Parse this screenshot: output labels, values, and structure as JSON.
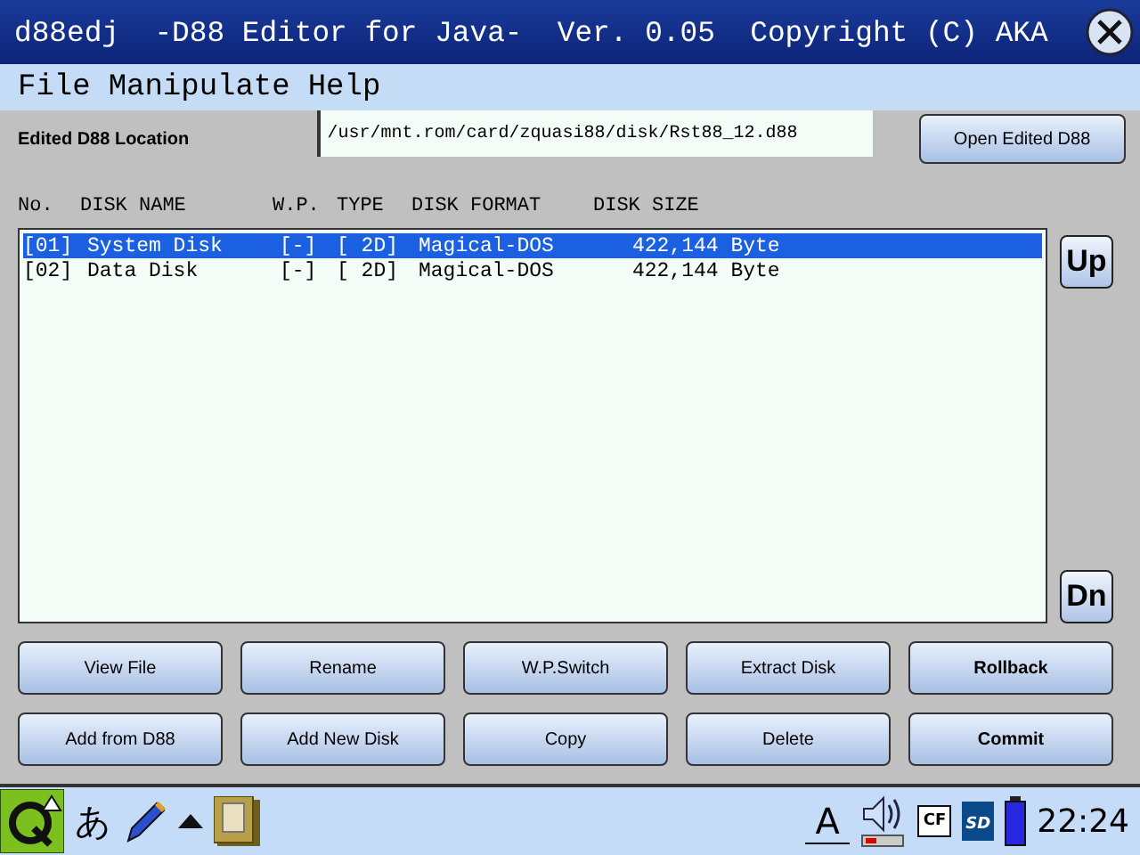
{
  "window": {
    "title": "d88edj  -D88 Editor for Java-  Ver. 0.05  Copyright (C) AKA"
  },
  "menu": [
    "File",
    "Manipulate",
    "Help"
  ],
  "location": {
    "label": "Edited D88 Location",
    "value": "/usr/mnt.rom/card/zquasi88/disk/Rst88_12.d88",
    "button": "Open Edited D88"
  },
  "columns": [
    "No.",
    "DISK NAME",
    "W.P.",
    "TYPE",
    "DISK FORMAT",
    "DISK SIZE"
  ],
  "rows": [
    {
      "no": "[01]",
      "name": "System Disk",
      "wp": "[-]",
      "type": "[ 2D]",
      "format": "Magical-DOS",
      "size": "422,144 Byte",
      "selected": true
    },
    {
      "no": "[02]",
      "name": "Data Disk",
      "wp": "[-]",
      "type": "[ 2D]",
      "format": "Magical-DOS",
      "size": "422,144 Byte",
      "selected": false
    }
  ],
  "scroll_buttons": [
    "Up",
    "Dn"
  ],
  "buttons": [
    {
      "label": "View File",
      "bold": false
    },
    {
      "label": "Rename",
      "bold": false
    },
    {
      "label": "W.P.Switch",
      "bold": false
    },
    {
      "label": "Extract Disk",
      "bold": false
    },
    {
      "label": "Rollback",
      "bold": true
    },
    {
      "label": "Add from D88",
      "bold": false
    },
    {
      "label": "Add New Disk",
      "bold": false
    },
    {
      "label": "Copy",
      "bold": false
    },
    {
      "label": "Delete",
      "bold": false
    },
    {
      "label": "Commit",
      "bold": true
    }
  ],
  "taskbar": {
    "input_mode": "あ",
    "font_indicator": "A",
    "cf_label": "CF",
    "sd_label": "SD",
    "clock": "22:24"
  }
}
